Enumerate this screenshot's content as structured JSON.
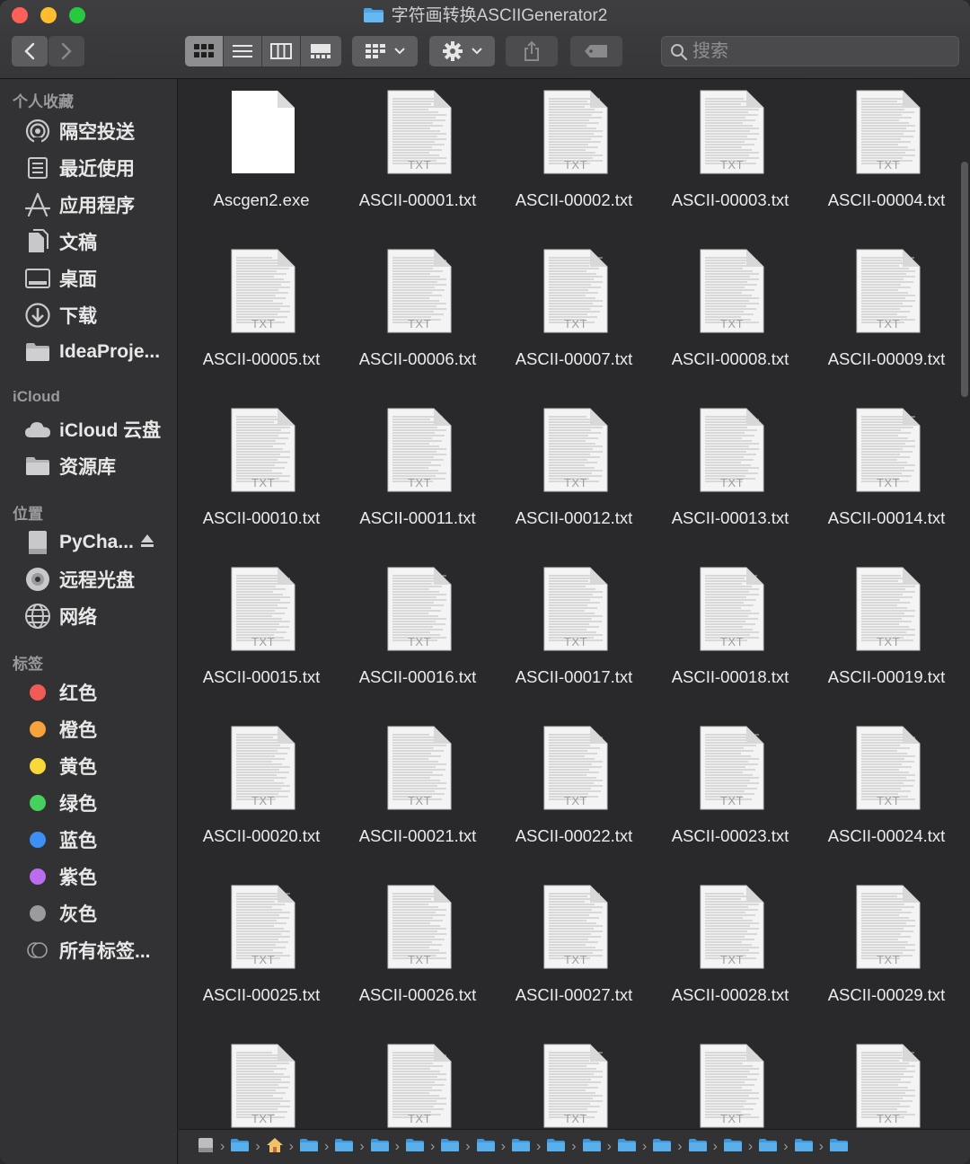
{
  "window": {
    "title": "字符画转换ASCIIGenerator2"
  },
  "toolbar": {
    "search_placeholder": "搜索"
  },
  "sidebar": {
    "sections": [
      {
        "label": "个人收藏",
        "items": [
          {
            "label": "隔空投送",
            "icon": "airdrop-icon"
          },
          {
            "label": "最近使用",
            "icon": "recents-icon"
          },
          {
            "label": "应用程序",
            "icon": "applications-icon"
          },
          {
            "label": "文稿",
            "icon": "documents-icon"
          },
          {
            "label": "桌面",
            "icon": "desktop-icon"
          },
          {
            "label": "下载",
            "icon": "downloads-icon"
          },
          {
            "label": "IdeaProje...",
            "icon": "folder-icon"
          }
        ]
      },
      {
        "label": "iCloud",
        "items": [
          {
            "label": "iCloud 云盘",
            "icon": "cloud-icon"
          },
          {
            "label": "资源库",
            "icon": "folder-icon"
          }
        ]
      },
      {
        "label": "位置",
        "items": [
          {
            "label": "PyCha...",
            "icon": "drive-icon"
          },
          {
            "label": "远程光盘",
            "icon": "disc-icon"
          },
          {
            "label": "网络",
            "icon": "network-icon"
          }
        ]
      },
      {
        "label": "标签",
        "items": [
          {
            "label": "红色",
            "color": "#f25a55"
          },
          {
            "label": "橙色",
            "color": "#f7a23c"
          },
          {
            "label": "黄色",
            "color": "#f9d93a"
          },
          {
            "label": "绿色",
            "color": "#46d05e"
          },
          {
            "label": "蓝色",
            "color": "#3b8ff5"
          },
          {
            "label": "紫色",
            "color": "#bb6cf0"
          },
          {
            "label": "灰色",
            "color": "#9b9b9e"
          },
          {
            "label": "所有标签...",
            "color": "all"
          }
        ]
      }
    ]
  },
  "files": {
    "doc_badge": "TXT",
    "items": [
      {
        "name": "Ascgen2.exe",
        "kind": "exe"
      },
      {
        "name": "ASCII-00001.txt",
        "kind": "txt"
      },
      {
        "name": "ASCII-00002.txt",
        "kind": "txt"
      },
      {
        "name": "ASCII-00003.txt",
        "kind": "txt"
      },
      {
        "name": "ASCII-00004.txt",
        "kind": "txt"
      },
      {
        "name": "ASCII-00005.txt",
        "kind": "txt"
      },
      {
        "name": "ASCII-00006.txt",
        "kind": "txt"
      },
      {
        "name": "ASCII-00007.txt",
        "kind": "txt"
      },
      {
        "name": "ASCII-00008.txt",
        "kind": "txt"
      },
      {
        "name": "ASCII-00009.txt",
        "kind": "txt"
      },
      {
        "name": "ASCII-00010.txt",
        "kind": "txt"
      },
      {
        "name": "ASCII-00011.txt",
        "kind": "txt"
      },
      {
        "name": "ASCII-00012.txt",
        "kind": "txt"
      },
      {
        "name": "ASCII-00013.txt",
        "kind": "txt"
      },
      {
        "name": "ASCII-00014.txt",
        "kind": "txt"
      },
      {
        "name": "ASCII-00015.txt",
        "kind": "txt"
      },
      {
        "name": "ASCII-00016.txt",
        "kind": "txt"
      },
      {
        "name": "ASCII-00017.txt",
        "kind": "txt"
      },
      {
        "name": "ASCII-00018.txt",
        "kind": "txt"
      },
      {
        "name": "ASCII-00019.txt",
        "kind": "txt"
      },
      {
        "name": "ASCII-00020.txt",
        "kind": "txt"
      },
      {
        "name": "ASCII-00021.txt",
        "kind": "txt"
      },
      {
        "name": "ASCII-00022.txt",
        "kind": "txt"
      },
      {
        "name": "ASCII-00023.txt",
        "kind": "txt"
      },
      {
        "name": "ASCII-00024.txt",
        "kind": "txt"
      },
      {
        "name": "ASCII-00025.txt",
        "kind": "txt"
      },
      {
        "name": "ASCII-00026.txt",
        "kind": "txt"
      },
      {
        "name": "ASCII-00027.txt",
        "kind": "txt"
      },
      {
        "name": "ASCII-00028.txt",
        "kind": "txt"
      },
      {
        "name": "ASCII-00029.txt",
        "kind": "txt"
      },
      {
        "name": "",
        "kind": "txt"
      },
      {
        "name": "",
        "kind": "txt"
      },
      {
        "name": "",
        "kind": "txt"
      },
      {
        "name": "",
        "kind": "txt"
      },
      {
        "name": "",
        "kind": "txt"
      }
    ]
  },
  "pathbar": {
    "crumbs": [
      "disk-icon",
      "user-folder-icon",
      "home-icon",
      "drive-folder-icon",
      "folder-icon",
      "folder-icon",
      "folder-icon",
      "folder-icon",
      "folder-icon",
      "folder-icon",
      "folder-icon",
      "folder-icon",
      "folder-icon",
      "folder-icon",
      "folder-icon",
      "folder-icon",
      "folder-icon",
      "folder-icon",
      "folder-icon"
    ]
  }
}
